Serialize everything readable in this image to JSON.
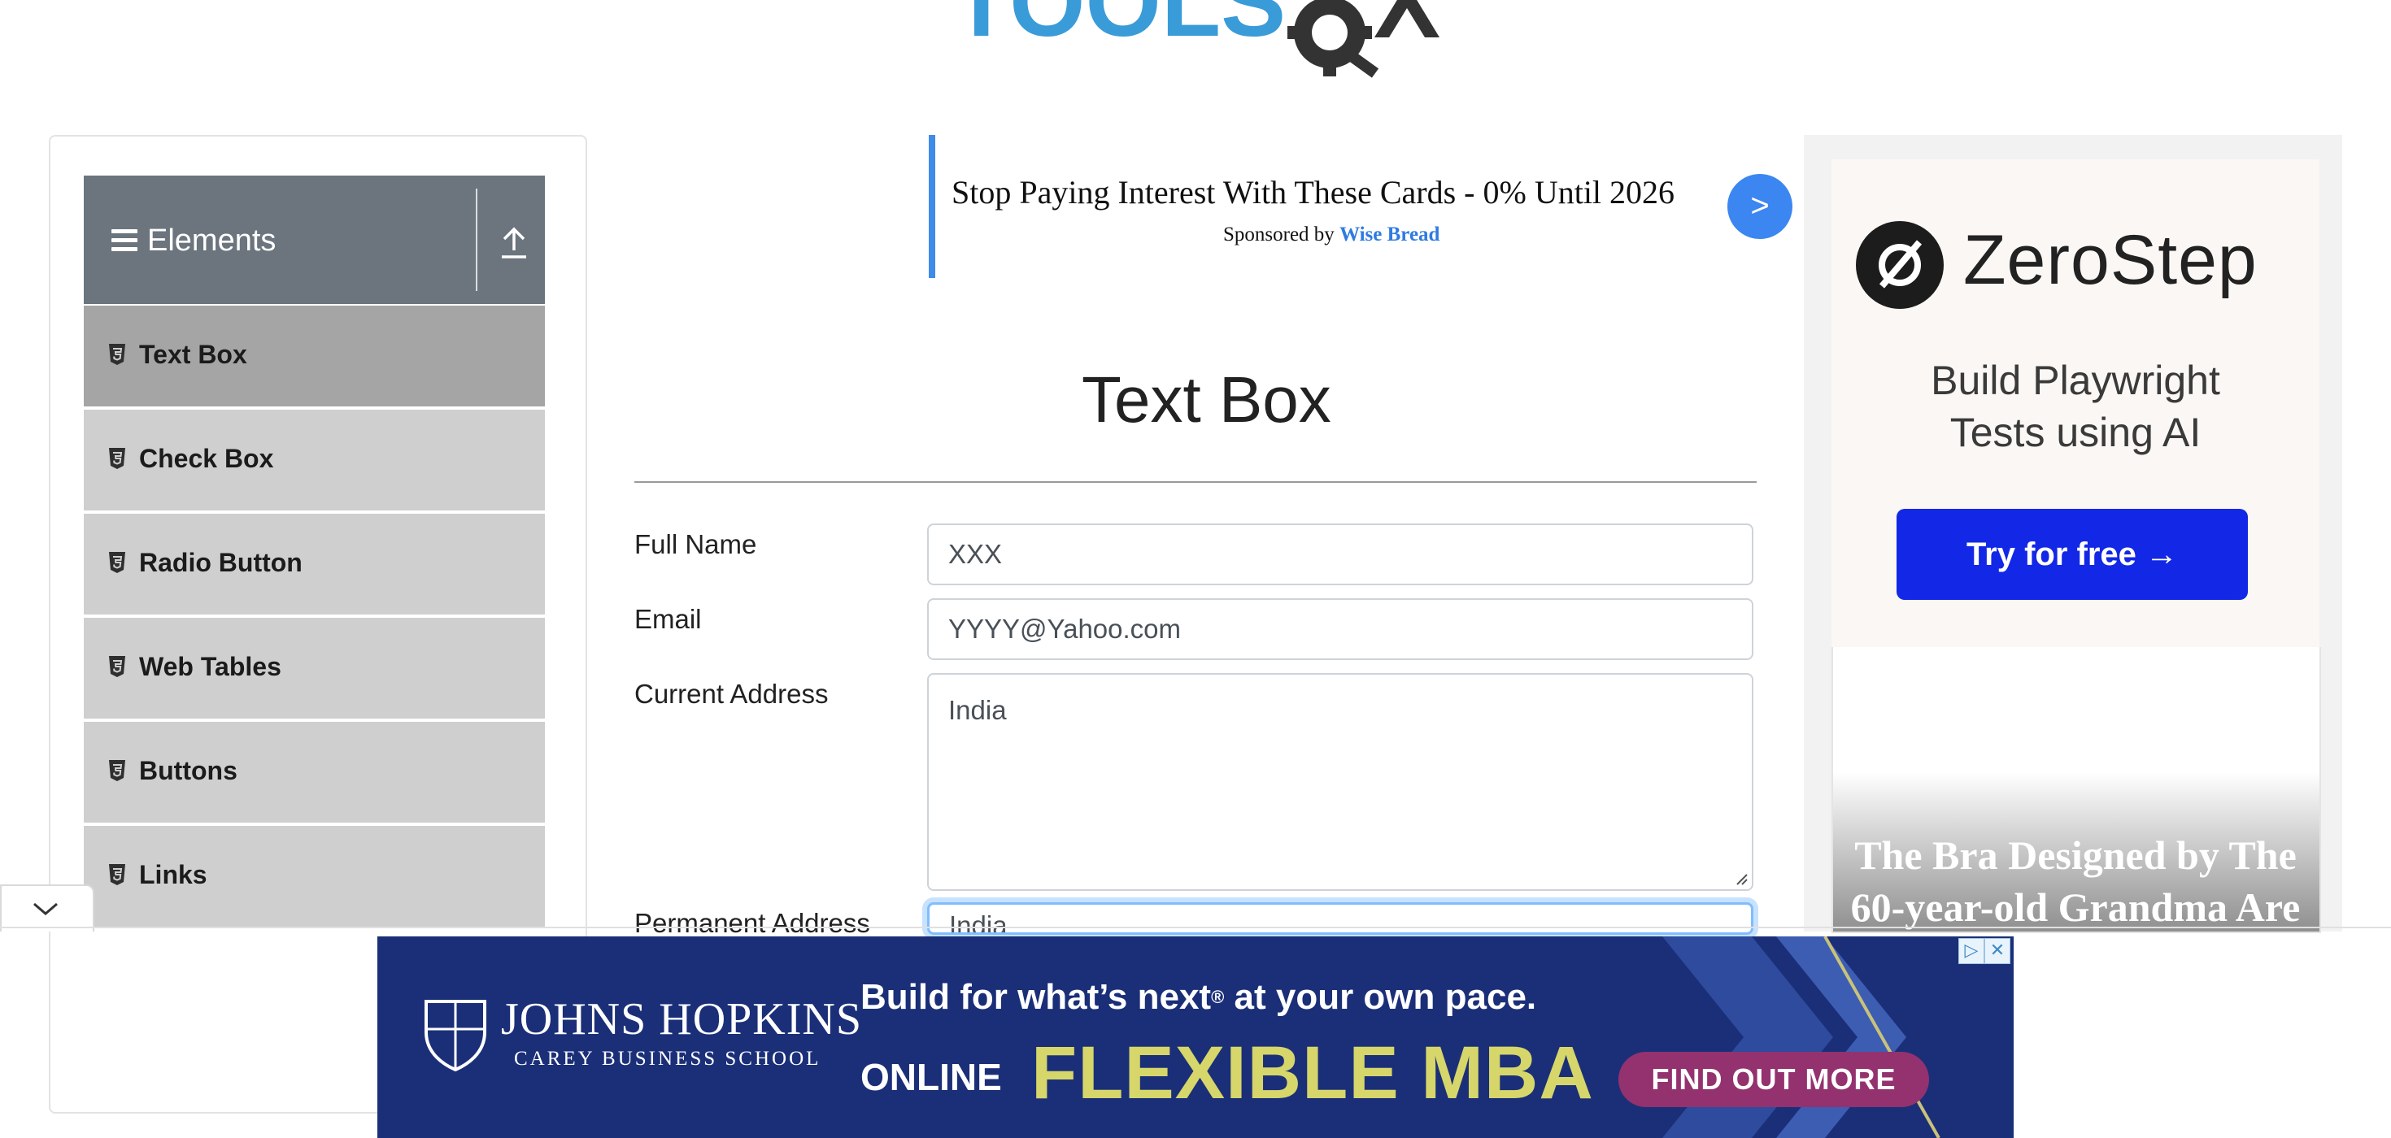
{
  "header": {
    "logo_text": "TOOLSQA"
  },
  "sidebar": {
    "group_title": "Elements",
    "items": [
      {
        "label": "Text Box",
        "active": true
      },
      {
        "label": "Check Box"
      },
      {
        "label": "Radio Button"
      },
      {
        "label": "Web Tables"
      },
      {
        "label": "Buttons"
      },
      {
        "label": "Links"
      }
    ]
  },
  "sponsored": {
    "title": "Stop Paying Interest With These Cards - 0% Until 2026",
    "prefix": "Sponsored by",
    "brand": "Wise Bread",
    "arrow": ">"
  },
  "form": {
    "page_title": "Text Box",
    "full_name": {
      "label": "Full Name",
      "value": "XXX"
    },
    "email": {
      "label": "Email",
      "value": "YYYY@Yahoo.com"
    },
    "current_address": {
      "label": "Current Address",
      "value": "India"
    },
    "permanent_address": {
      "label": "Permanent Address",
      "value": "India"
    }
  },
  "right_ad": {
    "brand": "ZeroStep",
    "tagline_1": "Build Playwright",
    "tagline_2": "Tests using AI",
    "cta": "Try for free →",
    "story_1": "The Bra Designed by The",
    "story_2": "60-year-old Grandma Are"
  },
  "bottom_ad": {
    "logo_main": "JOHNS HOPKINS",
    "logo_sub": "CAREY BUSINESS SCHOOL",
    "line1": "Build for what’s next",
    "line1_mark": "®",
    "line1_end": " at your own pace.",
    "online": "ONLINE",
    "program": "FLEXIBLE MBA",
    "cta": "FIND OUT MORE",
    "info_icon": "ad-choices-icon",
    "close_icon": "close-icon"
  },
  "colors": {
    "sidebar_header": "#6c757d",
    "menu_item": "#cfcfcf",
    "menu_active": "#a5a5a5",
    "accent_blue": "#3b86f0",
    "zerostep_button": "#1228e6",
    "jhu_navy": "#1b2f78",
    "jhu_gold": "#d6d66a",
    "jhu_cta": "#93326f"
  }
}
